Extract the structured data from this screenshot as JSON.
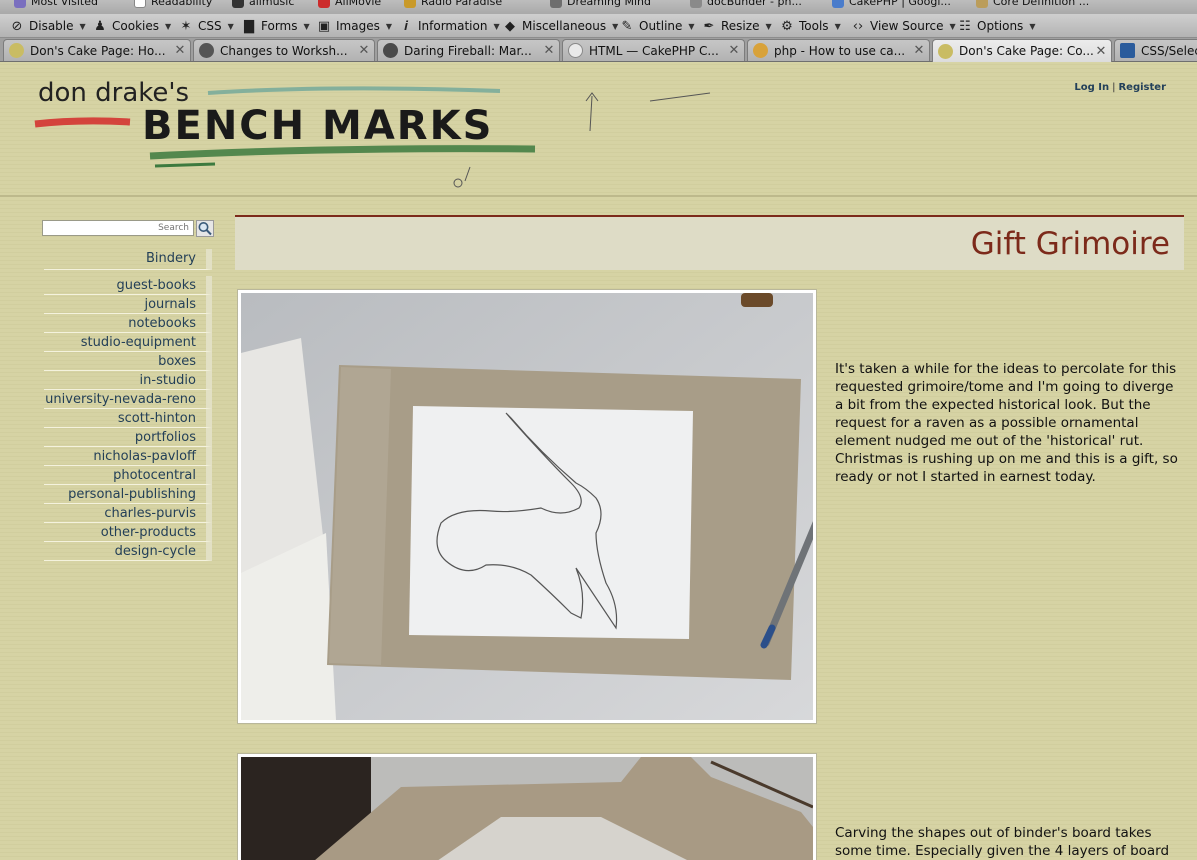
{
  "bookmarks": [
    {
      "label": "Most Visited",
      "color": "#7a6fbf"
    },
    {
      "label": "Readability",
      "color": "#ffffff"
    },
    {
      "label": "allmusic",
      "color": "#333333"
    },
    {
      "label": "AllMovie",
      "color": "#cc2b2b"
    },
    {
      "label": "Radio Paradise",
      "color": "#c99a2a"
    },
    {
      "label": "Dreaming Mind",
      "color": "#6e6e6e"
    },
    {
      "label": "docBunder - ph...",
      "color": "#8a8a8a"
    },
    {
      "label": "CakePHP | Googl...",
      "color": "#4a7ccb"
    },
    {
      "label": "Core Definition ...",
      "color": "#bb9d5b"
    }
  ],
  "devtoolbar": [
    {
      "label": "Disable",
      "icon": "no-entry-icon",
      "glyph": "⊘"
    },
    {
      "label": "Cookies",
      "icon": "person-icon",
      "glyph": "👤"
    },
    {
      "label": "CSS",
      "icon": "wand-icon",
      "glyph": "✶"
    },
    {
      "label": "Forms",
      "icon": "form-icon",
      "glyph": "▇"
    },
    {
      "label": "Images",
      "icon": "image-icon",
      "glyph": "▣"
    },
    {
      "label": "Information",
      "icon": "info-icon",
      "glyph": "𝒊"
    },
    {
      "label": "Miscellaneous",
      "icon": "cube-icon",
      "glyph": "◆"
    },
    {
      "label": "Outline",
      "icon": "pencil-icon",
      "glyph": "✎"
    },
    {
      "label": "Resize",
      "icon": "resize-icon",
      "glyph": "✒"
    },
    {
      "label": "Tools",
      "icon": "wrench-icon",
      "glyph": "🔧"
    },
    {
      "label": "View Source",
      "icon": "code-icon",
      "glyph": "‹›"
    },
    {
      "label": "Options",
      "icon": "options-icon",
      "glyph": "☷"
    }
  ],
  "tabs": [
    {
      "title": "Don's Cake Page: Ho...",
      "favicon_color": "#c9bc63",
      "active": false
    },
    {
      "title": "Changes to Worksh...",
      "favicon_color": "#555555",
      "active": false
    },
    {
      "title": "Daring Fireball: Mar...",
      "favicon_color": "#4a4a4a",
      "active": false
    },
    {
      "title": "HTML — CakePHP C...",
      "favicon_color": "#e9e9e9",
      "active": false
    },
    {
      "title": "php - How to use ca...",
      "favicon_color": "#d8a23a",
      "active": false
    },
    {
      "title": "Don's Cake Page: Co...",
      "favicon_color": "#c9bc63",
      "active": true
    },
    {
      "title": "CSS/Selec",
      "favicon_color": "#2a5b9c",
      "active": false
    }
  ],
  "site": {
    "logo_text_small": "don drake's",
    "logo_text_big": "BENCH MARKS",
    "login_label": "Log In",
    "separator": "|",
    "register_label": "Register"
  },
  "search": {
    "placeholder": "Search"
  },
  "sidebar": {
    "heading": "Bindery",
    "items": [
      "guest-books",
      "journals",
      "notebooks",
      "studio-equipment",
      "boxes",
      "in-studio",
      "university-nevada-reno",
      "scott-hinton",
      "portfolios",
      "nicholas-pavloff",
      "photocentral",
      "personal-publishing",
      "charles-purvis",
      "other-products",
      "design-cycle"
    ]
  },
  "main": {
    "title": "Gift Grimoire",
    "paragraphs": [
      "It's taken a while for the ideas to percolate for this requested grimoire/tome and I'm going to diverge a bit from the expected historical look. But the request for a raven as a possible ornamental element nudged me out of the 'historical' rut. Christmas is rushing up on me and this is a gift, so ready or not I started in earnest today.",
      "Carving the shapes out of binder's board takes some time. Especially given the 4 layers of board"
    ]
  },
  "colors": {
    "page_bg": "#d6d3a4",
    "title_color": "#7c2a1a",
    "link_color": "#233f57"
  }
}
